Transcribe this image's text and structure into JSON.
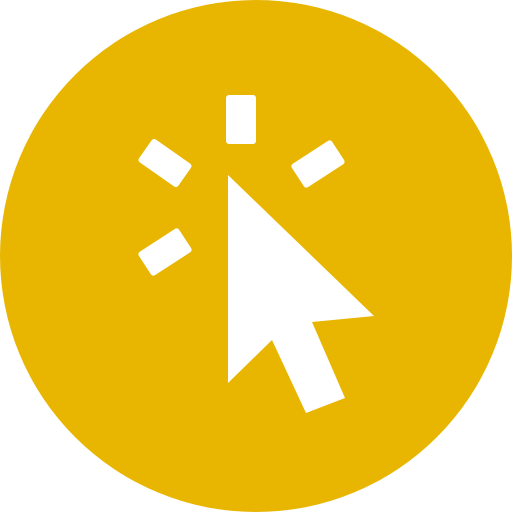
{
  "icon": {
    "name": "click-cursor-icon",
    "colors": {
      "background": "#E8B600",
      "foreground": "#FFFFFF"
    }
  }
}
